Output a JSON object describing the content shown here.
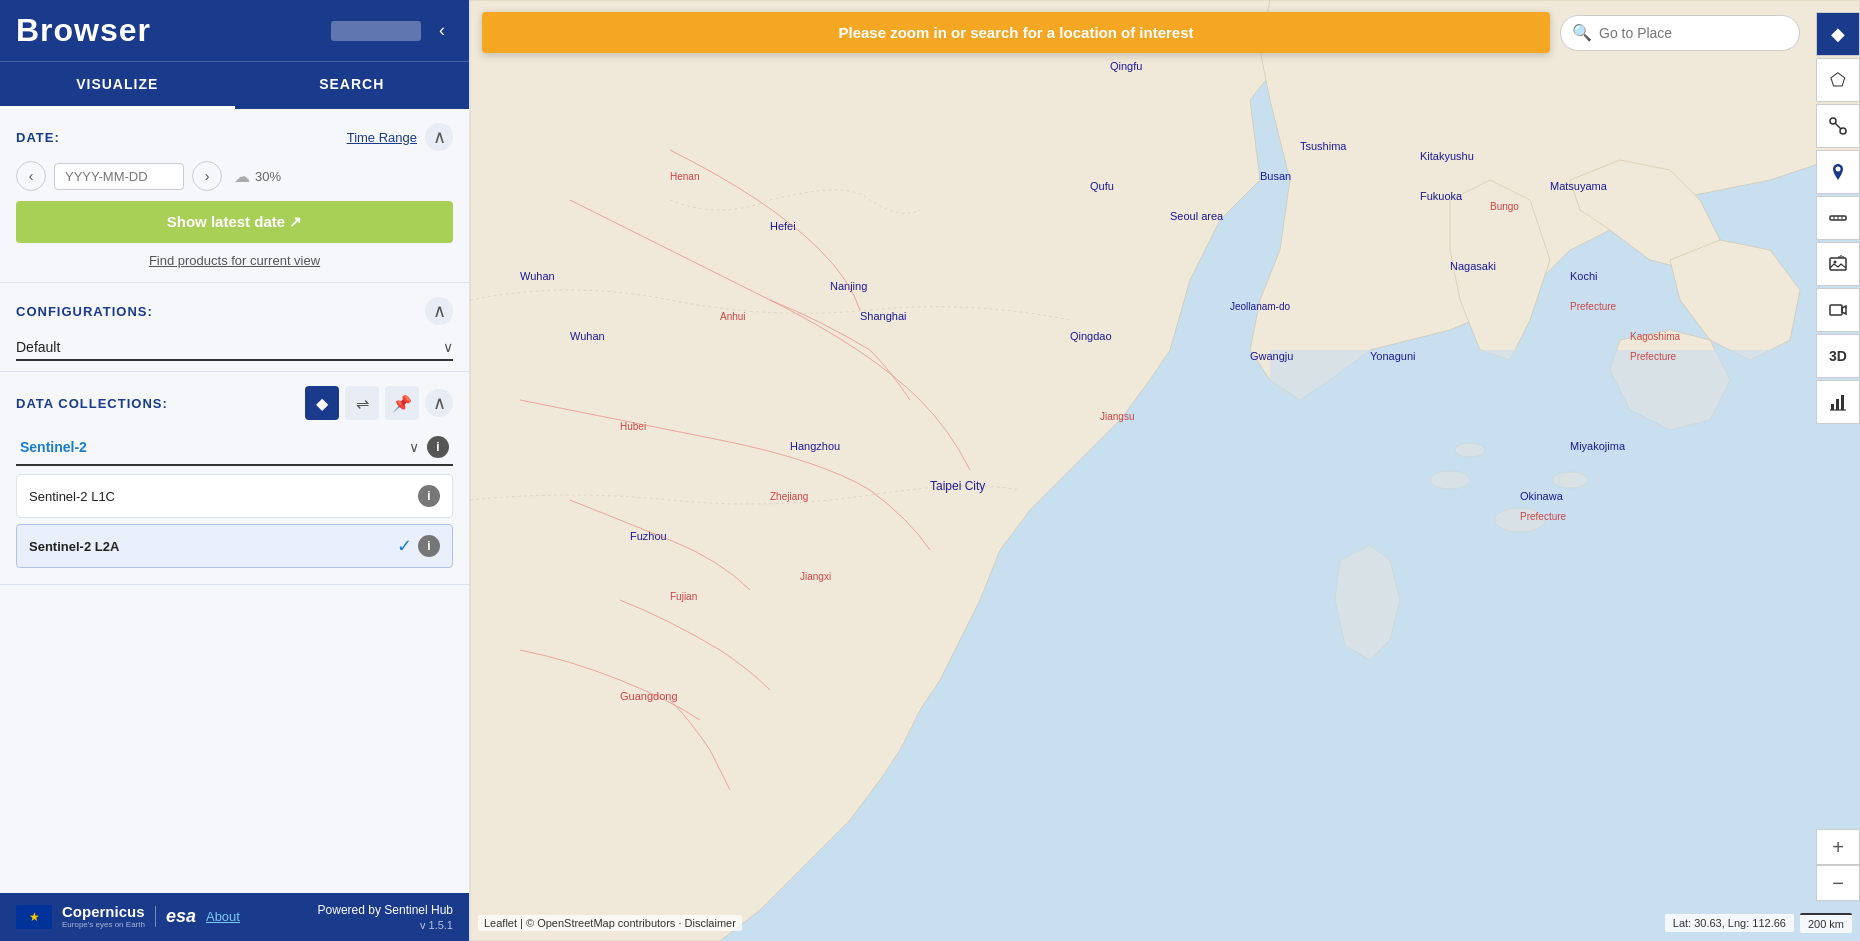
{
  "sidebar": {
    "title": "Browser",
    "collapse_label": "‹",
    "tabs": [
      {
        "id": "visualize",
        "label": "VISUALIZE"
      },
      {
        "id": "search",
        "label": "SEARCH"
      }
    ],
    "active_tab": "visualize"
  },
  "date_section": {
    "title": "DATE:",
    "time_range_label": "Time Range",
    "date_placeholder": "YYYY-MM-DD",
    "cloud_cover": "30%",
    "show_latest_label": "Show latest date ↗",
    "find_products_label": "Find products for current view"
  },
  "configurations_section": {
    "title": "CONFIGURATIONS:",
    "default_option": "Default"
  },
  "data_collections_section": {
    "title": "DATA COLLECTIONS:",
    "selected_collection": "Sentinel-2",
    "items": [
      {
        "id": "s2l1c",
        "label": "Sentinel-2 L1C",
        "selected": false
      },
      {
        "id": "s2l2a",
        "label": "Sentinel-2 L2A",
        "selected": true
      }
    ]
  },
  "footer": {
    "about_label": "About",
    "powered_by_label": "Powered by Sentinel Hub",
    "version": "v 1.5.1"
  },
  "map": {
    "zoom_alert": "Please zoom in or search for a location of interest",
    "search_placeholder": "Go to Place",
    "attribution": "Leaflet | © OpenStreetMap contributors · Disclaimer",
    "coordinates": "Lat: 30.63, Lng: 112.66",
    "scale": "200 km"
  },
  "toolbar": {
    "layers_icon": "◆",
    "pentagon_icon": "⬠",
    "line_icon": "╱",
    "pin_icon": "📍",
    "ruler_icon": "✏",
    "image_icon": "🖼",
    "film_icon": "🎬",
    "threed_label": "3D",
    "chart_icon": "📊"
  }
}
